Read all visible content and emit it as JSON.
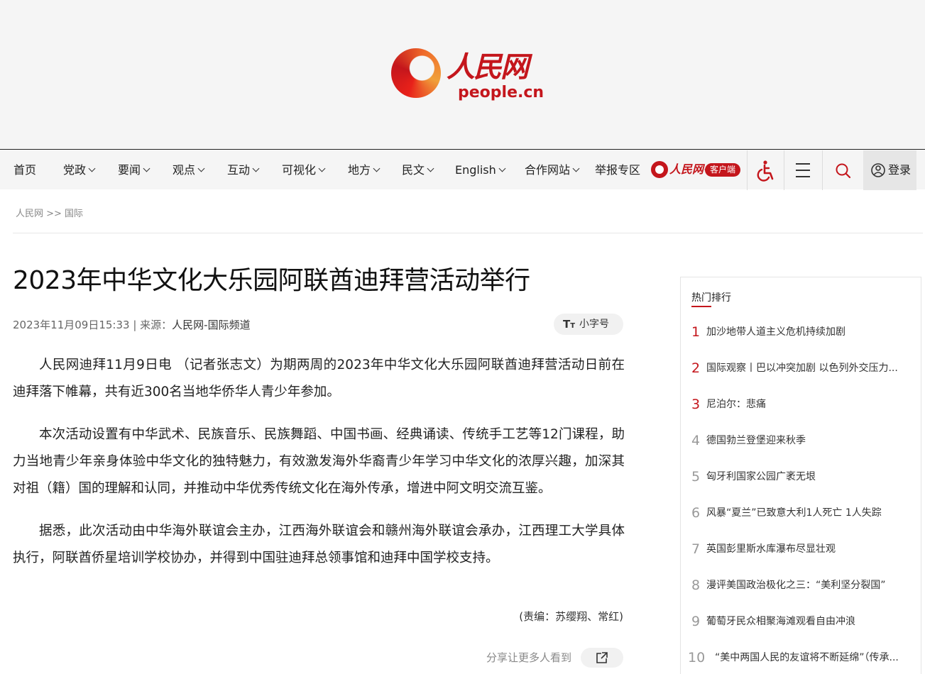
{
  "site": {
    "logo_cn": "人民网",
    "logo_en": "people.cn"
  },
  "nav": {
    "items": [
      {
        "label": "首页",
        "dropdown": false
      },
      {
        "label": "党政",
        "dropdown": true
      },
      {
        "label": "要闻",
        "dropdown": true
      },
      {
        "label": "观点",
        "dropdown": true
      },
      {
        "label": "互动",
        "dropdown": true
      },
      {
        "label": "可视化",
        "dropdown": true
      },
      {
        "label": "地方",
        "dropdown": true
      },
      {
        "label": "民文",
        "dropdown": true
      },
      {
        "label": "English",
        "dropdown": true
      },
      {
        "label": "合作网站",
        "dropdown": true
      },
      {
        "label": "举报专区",
        "dropdown": false
      }
    ],
    "app_name": "人民网+",
    "app_tag": "客户端",
    "accessibility_icon": "wheelchair-icon",
    "menu_icon": "hamburger-menu-icon",
    "search_icon": "search-icon",
    "login_icon": "user-icon",
    "login_label": "登录"
  },
  "breadcrumb": "人民网 >> 国际",
  "article": {
    "title": "2023年中华文化大乐园阿联酋迪拜营活动举行",
    "datetime": "2023年11月09日15:33 | 来源：",
    "source": "人民网-国际频道",
    "font_toggle_label": "小字号",
    "paragraphs": [
      "人民网迪拜11月9日电 （记者张志文）为期两周的2023年中华文化大乐园阿联酋迪拜营活动日前在迪拜落下帷幕，共有近300名当地华侨华人青少年参加。",
      "本次活动设置有中华武术、民族音乐、民族舞蹈、中国书画、经典诵读、传统手工艺等12门课程，助力当地青少年亲身体验中华文化的独特魅力，有效激发海外华裔青少年学习中华文化的浓厚兴趣，加深其对祖（籍）国的理解和认同，并推动中华优秀传统文化在海外传承，增进中阿文明交流互鉴。",
      "据悉，此次活动由中华海外联谊会主办，江西海外联谊会和赣州海外联谊会承办，江西理工大学具体执行，阿联酋侨星培训学校协办，并得到中国驻迪拜总领事馆和迪拜中国学校支持。"
    ],
    "editor": "(责编：苏缨翔、常红)",
    "share_label": "分享让更多人看到"
  },
  "sidebar": {
    "title": "热门排行",
    "items": [
      {
        "rank": "1",
        "text": "加沙地带人道主义危机持续加剧"
      },
      {
        "rank": "2",
        "text": "国际观察丨巴以冲突加剧 以色列外交压力..."
      },
      {
        "rank": "3",
        "text": "尼泊尔：悲痛"
      },
      {
        "rank": "4",
        "text": "德国勃兰登堡迎来秋季"
      },
      {
        "rank": "5",
        "text": "匈牙利国家公园广袤无垠"
      },
      {
        "rank": "6",
        "text": "风暴“夏兰”已致意大利1人死亡 1人失踪"
      },
      {
        "rank": "7",
        "text": "英国彭里斯水库瀑布尽显壮观"
      },
      {
        "rank": "8",
        "text": "漫评美国政治极化之三：“美利坚分裂国”"
      },
      {
        "rank": "9",
        "text": "葡萄牙民众相聚海滩观看自由冲浪"
      },
      {
        "rank": "10",
        "text": "“美中两国人民的友谊将不断延绵”（传承..."
      }
    ]
  },
  "colors": {
    "brand_red": "#c4161c",
    "top_rank_red": "#c4161c",
    "rank_gray": "#999999"
  }
}
